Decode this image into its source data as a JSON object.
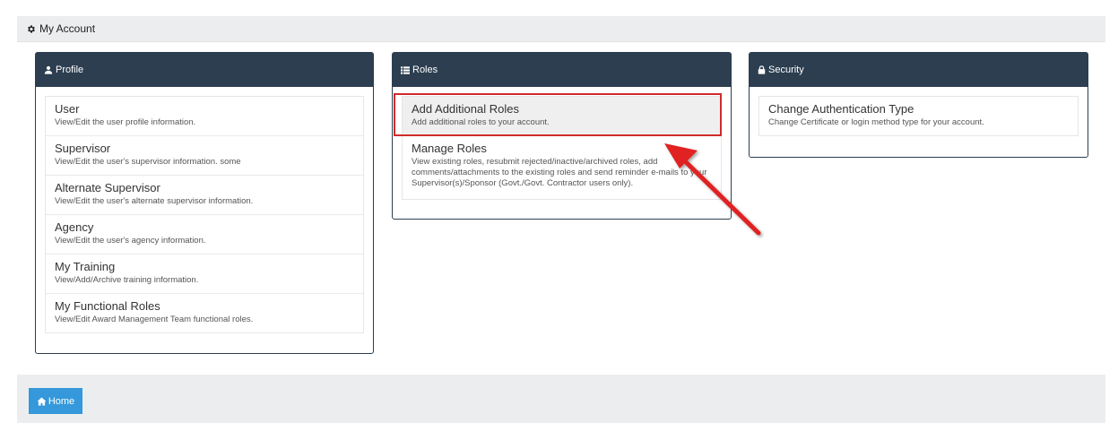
{
  "header": {
    "title": "My Account",
    "icon": "gear-icon"
  },
  "profile": {
    "title": "Profile",
    "icon": "user-icon",
    "items": [
      {
        "title": "User",
        "desc": "View/Edit the user profile information."
      },
      {
        "title": "Supervisor",
        "desc": "View/Edit the user's supervisor information. some"
      },
      {
        "title": "Alternate Supervisor",
        "desc": "View/Edit the user's alternate supervisor information."
      },
      {
        "title": "Agency",
        "desc": "View/Edit the user's agency information."
      },
      {
        "title": "My Training",
        "desc": "View/Add/Archive training information."
      },
      {
        "title": "My Functional Roles",
        "desc": "View/Edit Award Management Team functional roles."
      }
    ]
  },
  "roles": {
    "title": "Roles",
    "icon": "list-icon",
    "items": [
      {
        "title": "Add Additional Roles",
        "desc": "Add additional roles to your account."
      },
      {
        "title": "Manage Roles",
        "desc": "View existing roles, resubmit rejected/inactive/archived roles, add comments/attachments to the existing roles and send reminder e-mails to your Supervisor(s)/Sponsor (Govt./Govt. Contractor users only)."
      }
    ]
  },
  "security": {
    "title": "Security",
    "icon": "lock-icon",
    "items": [
      {
        "title": "Change Authentication Type",
        "desc": "Change Certificate or login method type for your account."
      }
    ]
  },
  "footer": {
    "home_label": "Home",
    "icon": "home-icon"
  },
  "colors": {
    "panel_header": "#2c3e50",
    "button": "#3498db",
    "highlight": "#d02a2a",
    "bar": "#ecedee"
  }
}
